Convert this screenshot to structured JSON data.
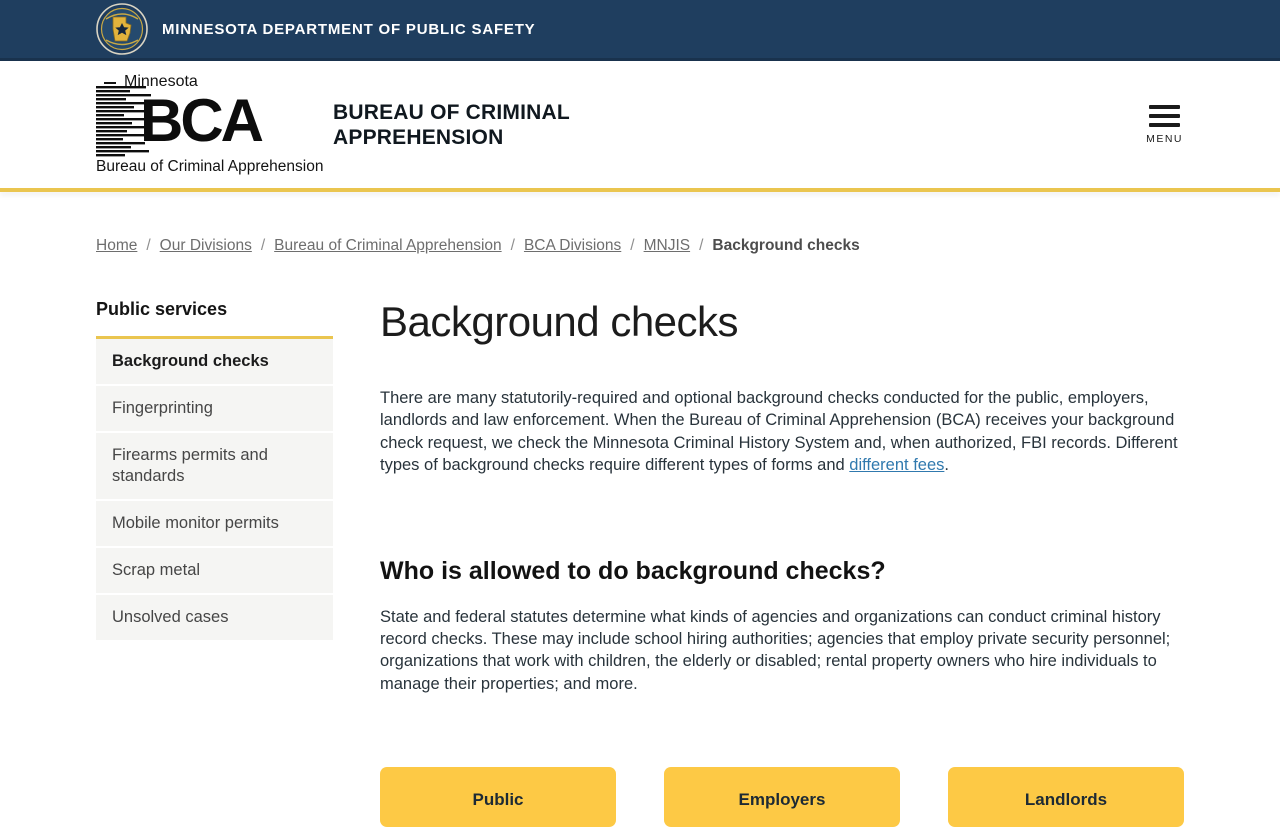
{
  "topbar": {
    "agency": "MINNESOTA DEPARTMENT OF PUBLIC SAFETY"
  },
  "header": {
    "logo": {
      "top": "Minnesota",
      "acronym": "BCA",
      "bottom": "Bureau of Criminal Apprehension"
    },
    "title_line1": "BUREAU OF CRIMINAL",
    "title_line2": "APPREHENSION",
    "menu_label": "MENU"
  },
  "breadcrumb": {
    "links": [
      "Home",
      "Our Divisions",
      "Bureau of Criminal Apprehension",
      "BCA Divisions",
      "MNJIS"
    ],
    "current": "Background checks",
    "separator": "/"
  },
  "sidebar": {
    "heading": "Public services",
    "items": [
      {
        "label": "Background checks",
        "active": true
      },
      {
        "label": "Fingerprinting",
        "active": false
      },
      {
        "label": "Firearms permits and standards",
        "active": false
      },
      {
        "label": "Mobile monitor permits",
        "active": false
      },
      {
        "label": "Scrap metal",
        "active": false
      },
      {
        "label": "Unsolved cases",
        "active": false
      }
    ]
  },
  "main": {
    "title": "Background checks",
    "intro_before_link": "There are many statutorily-required and optional background checks conducted for the public, employers, landlords and law enforcement. When the Bureau of Criminal Apprehension (BCA) receives your background check request, we check the Minnesota Criminal History System and, when authorized, FBI records. Different types of background checks require different types of forms and ",
    "intro_link": "different fees",
    "intro_after_link": ".",
    "section_heading": "Who is allowed to do background checks?",
    "section_body": "State and federal statutes determine what kinds of agencies and organizations can conduct criminal history record checks. These may include school hiring authorities; agencies that employ private security personnel; organizations that work with children, the elderly or disabled; rental property owners who hire individuals to manage their properties; and more.",
    "buttons": [
      "Public",
      "Employers",
      "Landlords"
    ]
  },
  "colors": {
    "navy": "#1f3e5f",
    "gold": "#eac54f",
    "btn-yellow": "#fdc945",
    "link": "#3079ae",
    "text": "#28333b",
    "item-bg": "#f5f5f3"
  }
}
